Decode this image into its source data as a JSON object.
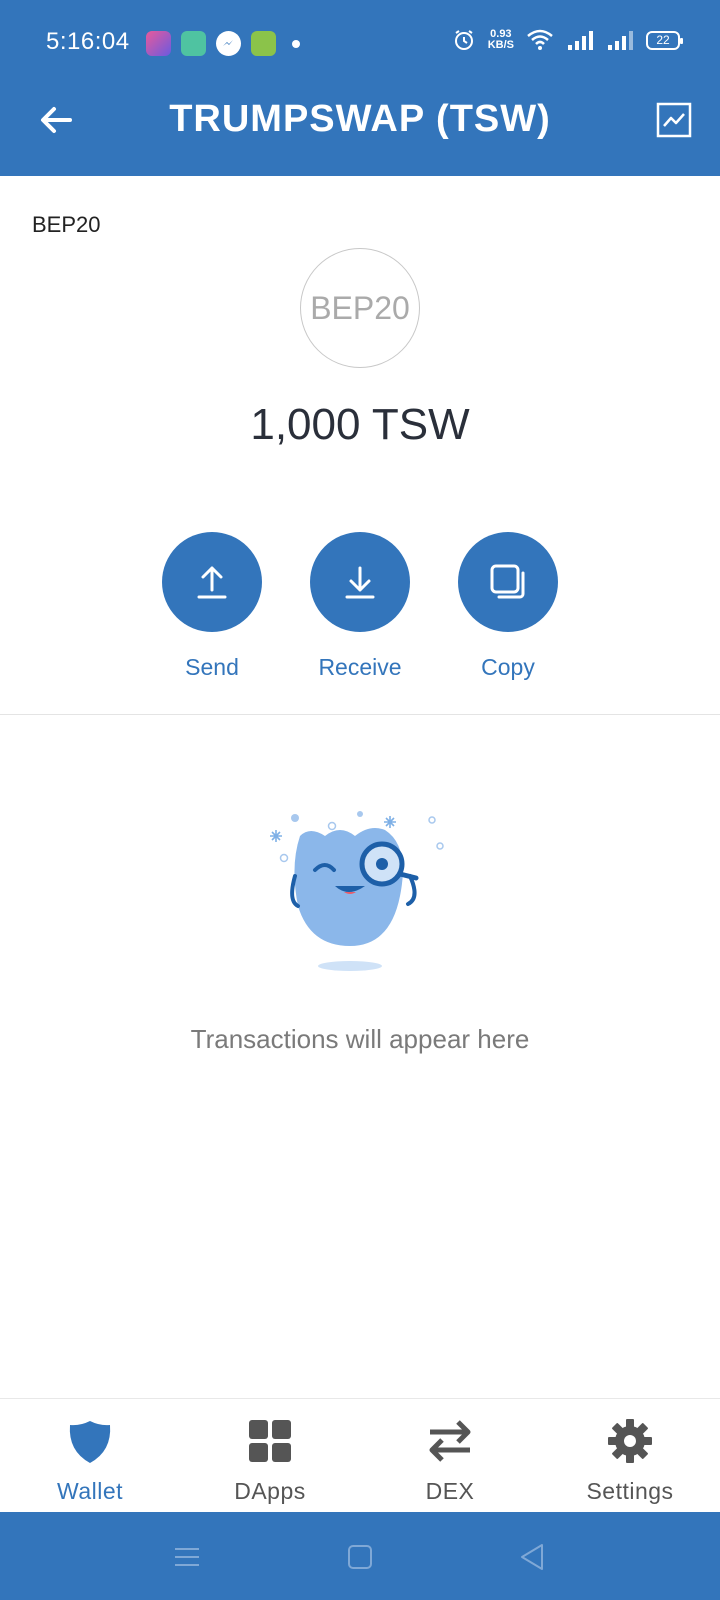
{
  "status_bar": {
    "time": "5:16:04",
    "network_speed_value": "0.93",
    "network_speed_unit": "KB/S",
    "battery": "22"
  },
  "app_bar": {
    "title": "TRUMPSWAP (TSW)"
  },
  "token": {
    "network": "BEP20",
    "logo_text": "BEP20",
    "balance": "1,000 TSW"
  },
  "actions": [
    {
      "label": "Send"
    },
    {
      "label": "Receive"
    },
    {
      "label": "Copy"
    }
  ],
  "empty_state": {
    "message": "Transactions will appear here"
  },
  "tabs": [
    {
      "label": "Wallet",
      "active": true
    },
    {
      "label": "DApps",
      "active": false
    },
    {
      "label": "DEX",
      "active": false
    },
    {
      "label": "Settings",
      "active": false
    }
  ],
  "colors": {
    "primary": "#3375BB",
    "tab_inactive": "#555555"
  }
}
